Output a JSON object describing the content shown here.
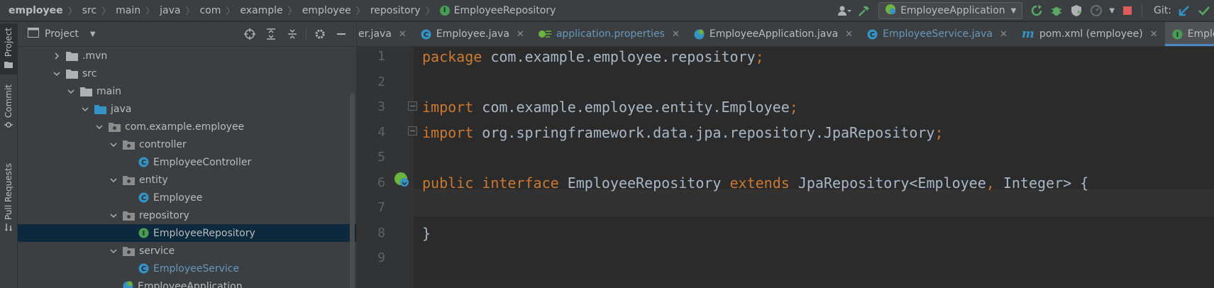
{
  "breadcrumbs": [
    "employee",
    "src",
    "main",
    "java",
    "com",
    "example",
    "employee",
    "repository",
    "EmployeeRepository"
  ],
  "toolbar": {
    "run_config": "EmployeeApplication",
    "git_label": "Git:"
  },
  "sidebar": {
    "tabs": [
      "Project",
      "Commit",
      "Pull Requests"
    ]
  },
  "project_panel": {
    "title": "Project",
    "tree": [
      {
        "label": ".mvn",
        "icon": "folder",
        "expanded": false
      },
      {
        "label": "src",
        "icon": "folder",
        "expanded": true
      },
      {
        "label": "main",
        "icon": "folder",
        "expanded": true
      },
      {
        "label": "java",
        "icon": "source-folder",
        "expanded": true
      },
      {
        "label": "com.example.employee",
        "icon": "package",
        "expanded": true
      },
      {
        "label": "controller",
        "icon": "package",
        "expanded": true
      },
      {
        "label": "EmployeeController",
        "icon": "class"
      },
      {
        "label": "entity",
        "icon": "package",
        "expanded": true
      },
      {
        "label": "Employee",
        "icon": "class"
      },
      {
        "label": "repository",
        "icon": "package",
        "expanded": true
      },
      {
        "label": "EmployeeRepository",
        "icon": "interface",
        "selected": true
      },
      {
        "label": "service",
        "icon": "package",
        "expanded": true
      },
      {
        "label": "EmployeeService",
        "icon": "class",
        "modified": true
      },
      {
        "label": "EmployeeApplication",
        "icon": "spring-class"
      }
    ]
  },
  "editor_tabs": [
    {
      "label": "er.java",
      "icon": "none",
      "style": "normal"
    },
    {
      "label": "Employee.java",
      "icon": "class",
      "style": "normal"
    },
    {
      "label": "application.properties",
      "icon": "spring",
      "style": "blue"
    },
    {
      "label": "EmployeeApplication.java",
      "icon": "spring-class",
      "style": "normal"
    },
    {
      "label": "EmployeeService.java",
      "icon": "class",
      "style": "blue"
    },
    {
      "label": "pom.xml (employee)",
      "icon": "maven",
      "style": "normal"
    },
    {
      "label": "EmployeeRe",
      "icon": "interface",
      "style": "active"
    }
  ],
  "code": {
    "lines": [
      [
        {
          "t": "package",
          "c": "kw"
        },
        {
          "t": " com.example.employee.repository"
        },
        {
          "t": ";",
          "c": "semi"
        }
      ],
      [],
      [
        {
          "t": "import",
          "c": "kw"
        },
        {
          "t": " com.example.employee.entity.Employee"
        },
        {
          "t": ";",
          "c": "semi"
        }
      ],
      [
        {
          "t": "import",
          "c": "kw"
        },
        {
          "t": " org.springframework.data.jpa.repository.JpaRepository"
        },
        {
          "t": ";",
          "c": "semi"
        }
      ],
      [],
      [
        {
          "t": "public",
          "c": "kw"
        },
        {
          "t": " "
        },
        {
          "t": "interface",
          "c": "kw"
        },
        {
          "t": " EmployeeRepository "
        },
        {
          "t": "extends",
          "c": "kw"
        },
        {
          "t": " JpaRepository<Employee"
        },
        {
          "t": ",",
          "c": "semi"
        },
        {
          "t": " Integer> {"
        }
      ],
      [],
      [
        {
          "t": "}"
        }
      ],
      []
    ],
    "line_numbers": [
      "1",
      "2",
      "3",
      "4",
      "5",
      "6",
      "7",
      "8",
      "9"
    ]
  },
  "colors": {
    "keyword": "#cc7832",
    "text": "#a9b7c6",
    "selection": "#0d293e",
    "accent": "#4a88c7"
  }
}
